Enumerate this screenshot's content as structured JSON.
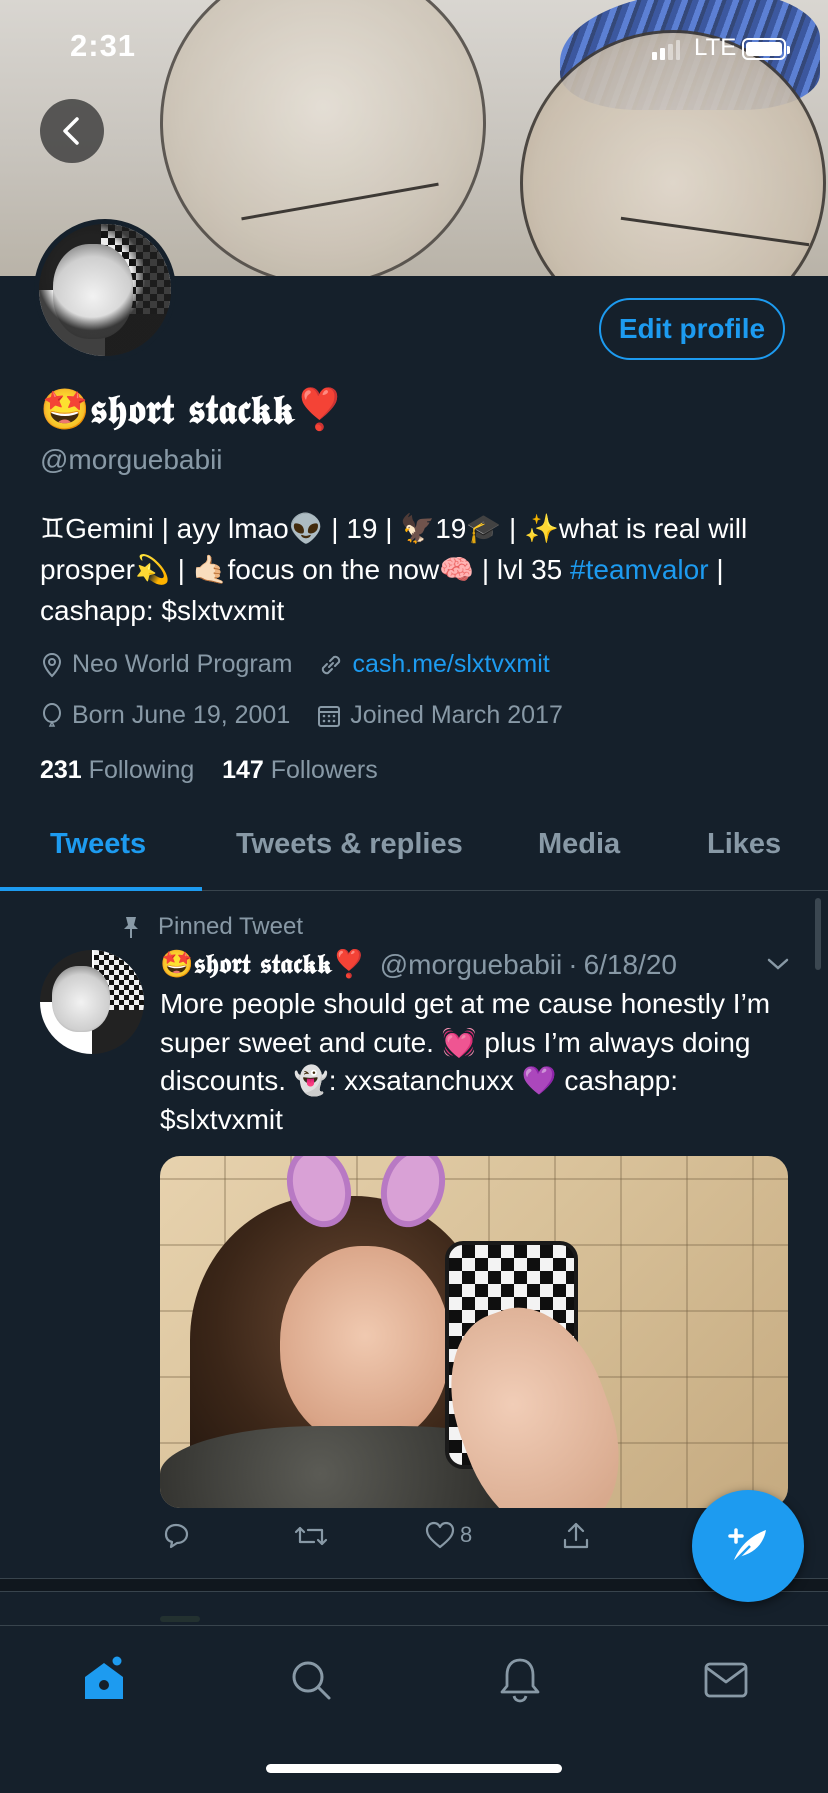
{
  "status_bar": {
    "time": "2:31",
    "carrier": "LTE",
    "icons": [
      "signal-icon",
      "battery-icon"
    ]
  },
  "profile": {
    "display_name": "🤩𝖘𝖍𝖔𝖗𝖙 𝖘𝖙𝖆𝖈𝖐𝖐❣️",
    "handle": "@morguebabii",
    "edit_profile_label": "Edit profile",
    "bio_part1": "♊Gemini | ayy lmao👽 | 19 | 🦅19🎓 | ✨what is real will prosper💫 | 🤙🏻focus on the now🧠 | lvl 35 ",
    "bio_hashtag": "#teamvalor",
    "bio_part2": " | cashapp: $slxtvxmit",
    "location": "Neo World Program",
    "website": "cash.me/slxtvxmit",
    "birthday": "Born June 19, 2001",
    "joined": "Joined March 2017",
    "following_count": "231",
    "following_label": "Following",
    "followers_count": "147",
    "followers_label": "Followers"
  },
  "tabs": [
    {
      "label": "Tweets",
      "active": true
    },
    {
      "label": "Tweets & replies",
      "active": false
    },
    {
      "label": "Media",
      "active": false
    },
    {
      "label": "Likes",
      "active": false
    }
  ],
  "pinned_tweet": {
    "pinned_label": "Pinned Tweet",
    "author_name": "🤩𝖘𝖍𝖔𝖗𝖙 𝖘𝖙𝖆𝖈𝖐𝖐❣️",
    "author_handle": "@morguebabii",
    "separator": "·",
    "date": "6/18/20",
    "text": "More people should get at me cause honestly I’m super sweet and cute. 💓 plus I’m always doing discounts. 👻: xxsatanchuxx 💜 cashapp: $slxtvxmit",
    "like_count": "8"
  },
  "colors": {
    "background": "#15202b",
    "accent": "#1d9bf0",
    "secondary_text": "#8899a6",
    "divider": "#38444d"
  },
  "bottom_nav": {
    "items": [
      "home-icon",
      "search-icon",
      "notifications-icon",
      "messages-icon"
    ],
    "active": "home-icon"
  }
}
